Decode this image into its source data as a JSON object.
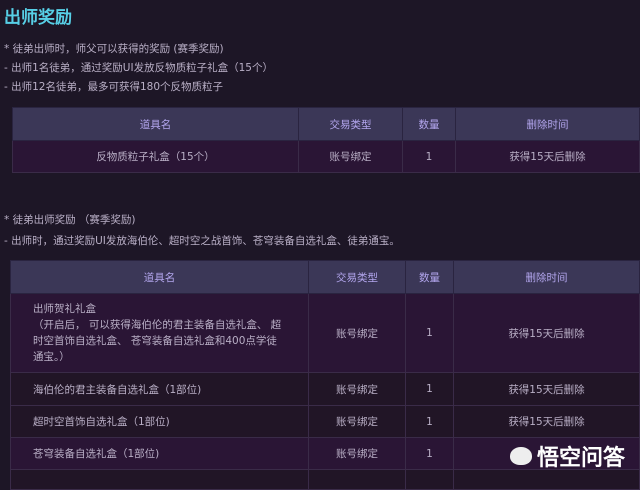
{
  "title": "出师奖励",
  "section1": {
    "lines": [
      "* 徒弟出师时，师父可以获得的奖励 (赛季奖励)",
      "- 出师1名徒弟，通过奖励UI发放反物质粒子礼盒（15个）",
      "- 出师12名徒弟，最多可获得180个反物质粒子"
    ],
    "headers": [
      "道具名",
      "交易类型",
      "数量",
      "删除时间"
    ],
    "rows": [
      [
        "反物质粒子礼盒（15个）",
        "账号绑定",
        "1",
        "获得15天后删除"
      ]
    ]
  },
  "section2": {
    "lines": [
      "* 徒弟出师奖励 （赛季奖励)",
      "- 出师时，通过奖励UI发放海伯伦、超时空之战首饰、苍穹装备自选礼盒、徒弟通宝。"
    ],
    "headers": [
      "道具名",
      "交易类型",
      "数量",
      "删除时间"
    ],
    "rows": [
      [
        "出师贺礼礼盒",
        "账号绑定",
        "1",
        "获得15天后删除"
      ],
      [
        "海伯伦的君主装备自选礼盒（1部位)",
        "账号绑定",
        "1",
        "获得15天后删除"
      ],
      [
        "超时空首饰自选礼盒（1部位)",
        "账号绑定",
        "1",
        "获得15天后删除"
      ],
      [
        "苍穹装备自选礼盒（1部位)",
        "账号绑定",
        "1",
        ""
      ]
    ],
    "row0_note": "（开启后， 可以获得海伯伦的君主装备自选礼盒、 超时空首饰自选礼盒、 苍穹装备自选礼盒和400点学徒通宝。）"
  },
  "watermark": "悟空问答"
}
